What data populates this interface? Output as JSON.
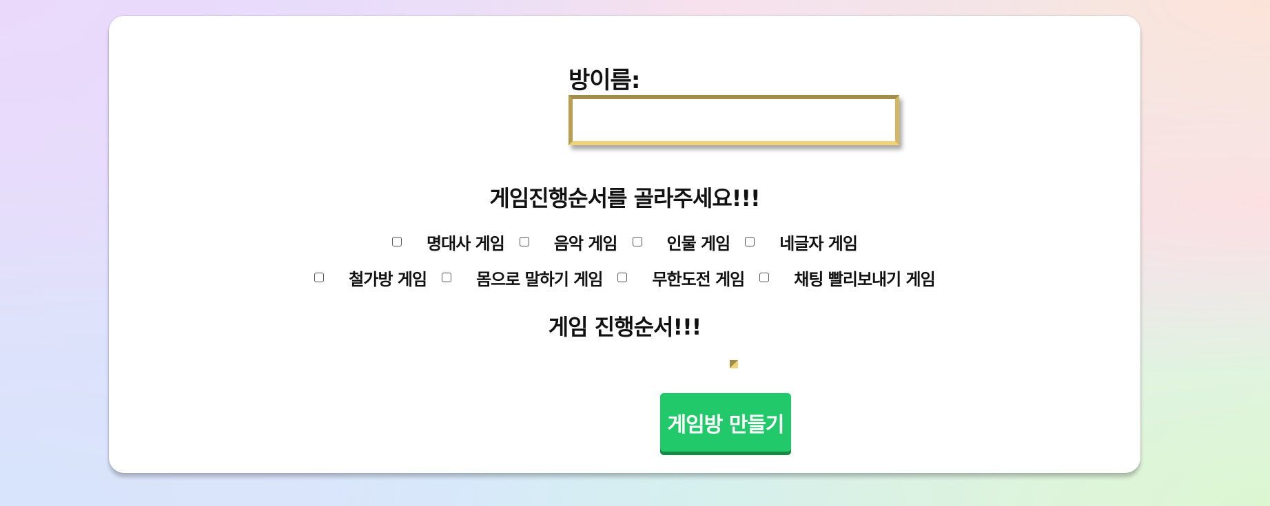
{
  "form": {
    "room_name_label": "방이름:",
    "room_name_value": "",
    "order_prompt": "게임진행순서를 골라주세요!!!",
    "games_row1": [
      {
        "label": "명대사 게임",
        "checked": false
      },
      {
        "label": "음악 게임",
        "checked": false
      },
      {
        "label": "인물 게임",
        "checked": false
      },
      {
        "label": "네글자 게임",
        "checked": false
      }
    ],
    "games_row2": [
      {
        "label": "철가방 게임",
        "checked": false
      },
      {
        "label": "몸으로 말하기 게임",
        "checked": false
      },
      {
        "label": "무한도전 게임",
        "checked": false
      },
      {
        "label": "채팅 빨리보내기 게임",
        "checked": false
      }
    ],
    "order_heading": "게임 진행순서!!!",
    "create_button_label": "게임방 만들기"
  },
  "colors": {
    "button_green": "#22c96b",
    "button_green_shadow": "#148a44",
    "input_border_gold": "#d4b763"
  }
}
